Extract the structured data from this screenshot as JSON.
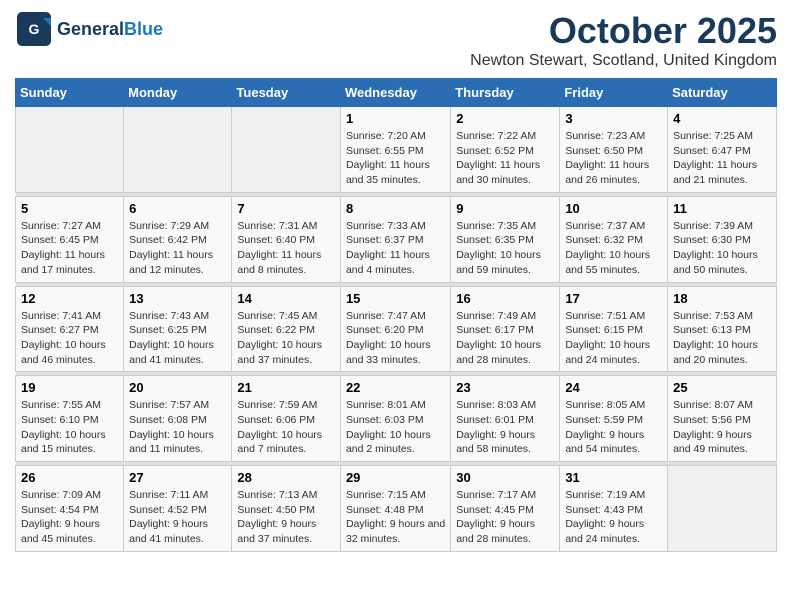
{
  "header": {
    "logo_general": "General",
    "logo_blue": "Blue",
    "month": "October 2025",
    "location": "Newton Stewart, Scotland, United Kingdom"
  },
  "weekdays": [
    "Sunday",
    "Monday",
    "Tuesday",
    "Wednesday",
    "Thursday",
    "Friday",
    "Saturday"
  ],
  "weeks": [
    [
      {
        "day": "",
        "sunrise": "",
        "sunset": "",
        "daylight": ""
      },
      {
        "day": "",
        "sunrise": "",
        "sunset": "",
        "daylight": ""
      },
      {
        "day": "",
        "sunrise": "",
        "sunset": "",
        "daylight": ""
      },
      {
        "day": "1",
        "sunrise": "Sunrise: 7:20 AM",
        "sunset": "Sunset: 6:55 PM",
        "daylight": "Daylight: 11 hours and 35 minutes."
      },
      {
        "day": "2",
        "sunrise": "Sunrise: 7:22 AM",
        "sunset": "Sunset: 6:52 PM",
        "daylight": "Daylight: 11 hours and 30 minutes."
      },
      {
        "day": "3",
        "sunrise": "Sunrise: 7:23 AM",
        "sunset": "Sunset: 6:50 PM",
        "daylight": "Daylight: 11 hours and 26 minutes."
      },
      {
        "day": "4",
        "sunrise": "Sunrise: 7:25 AM",
        "sunset": "Sunset: 6:47 PM",
        "daylight": "Daylight: 11 hours and 21 minutes."
      }
    ],
    [
      {
        "day": "5",
        "sunrise": "Sunrise: 7:27 AM",
        "sunset": "Sunset: 6:45 PM",
        "daylight": "Daylight: 11 hours and 17 minutes."
      },
      {
        "day": "6",
        "sunrise": "Sunrise: 7:29 AM",
        "sunset": "Sunset: 6:42 PM",
        "daylight": "Daylight: 11 hours and 12 minutes."
      },
      {
        "day": "7",
        "sunrise": "Sunrise: 7:31 AM",
        "sunset": "Sunset: 6:40 PM",
        "daylight": "Daylight: 11 hours and 8 minutes."
      },
      {
        "day": "8",
        "sunrise": "Sunrise: 7:33 AM",
        "sunset": "Sunset: 6:37 PM",
        "daylight": "Daylight: 11 hours and 4 minutes."
      },
      {
        "day": "9",
        "sunrise": "Sunrise: 7:35 AM",
        "sunset": "Sunset: 6:35 PM",
        "daylight": "Daylight: 10 hours and 59 minutes."
      },
      {
        "day": "10",
        "sunrise": "Sunrise: 7:37 AM",
        "sunset": "Sunset: 6:32 PM",
        "daylight": "Daylight: 10 hours and 55 minutes."
      },
      {
        "day": "11",
        "sunrise": "Sunrise: 7:39 AM",
        "sunset": "Sunset: 6:30 PM",
        "daylight": "Daylight: 10 hours and 50 minutes."
      }
    ],
    [
      {
        "day": "12",
        "sunrise": "Sunrise: 7:41 AM",
        "sunset": "Sunset: 6:27 PM",
        "daylight": "Daylight: 10 hours and 46 minutes."
      },
      {
        "day": "13",
        "sunrise": "Sunrise: 7:43 AM",
        "sunset": "Sunset: 6:25 PM",
        "daylight": "Daylight: 10 hours and 41 minutes."
      },
      {
        "day": "14",
        "sunrise": "Sunrise: 7:45 AM",
        "sunset": "Sunset: 6:22 PM",
        "daylight": "Daylight: 10 hours and 37 minutes."
      },
      {
        "day": "15",
        "sunrise": "Sunrise: 7:47 AM",
        "sunset": "Sunset: 6:20 PM",
        "daylight": "Daylight: 10 hours and 33 minutes."
      },
      {
        "day": "16",
        "sunrise": "Sunrise: 7:49 AM",
        "sunset": "Sunset: 6:17 PM",
        "daylight": "Daylight: 10 hours and 28 minutes."
      },
      {
        "day": "17",
        "sunrise": "Sunrise: 7:51 AM",
        "sunset": "Sunset: 6:15 PM",
        "daylight": "Daylight: 10 hours and 24 minutes."
      },
      {
        "day": "18",
        "sunrise": "Sunrise: 7:53 AM",
        "sunset": "Sunset: 6:13 PM",
        "daylight": "Daylight: 10 hours and 20 minutes."
      }
    ],
    [
      {
        "day": "19",
        "sunrise": "Sunrise: 7:55 AM",
        "sunset": "Sunset: 6:10 PM",
        "daylight": "Daylight: 10 hours and 15 minutes."
      },
      {
        "day": "20",
        "sunrise": "Sunrise: 7:57 AM",
        "sunset": "Sunset: 6:08 PM",
        "daylight": "Daylight: 10 hours and 11 minutes."
      },
      {
        "day": "21",
        "sunrise": "Sunrise: 7:59 AM",
        "sunset": "Sunset: 6:06 PM",
        "daylight": "Daylight: 10 hours and 7 minutes."
      },
      {
        "day": "22",
        "sunrise": "Sunrise: 8:01 AM",
        "sunset": "Sunset: 6:03 PM",
        "daylight": "Daylight: 10 hours and 2 minutes."
      },
      {
        "day": "23",
        "sunrise": "Sunrise: 8:03 AM",
        "sunset": "Sunset: 6:01 PM",
        "daylight": "Daylight: 9 hours and 58 minutes."
      },
      {
        "day": "24",
        "sunrise": "Sunrise: 8:05 AM",
        "sunset": "Sunset: 5:59 PM",
        "daylight": "Daylight: 9 hours and 54 minutes."
      },
      {
        "day": "25",
        "sunrise": "Sunrise: 8:07 AM",
        "sunset": "Sunset: 5:56 PM",
        "daylight": "Daylight: 9 hours and 49 minutes."
      }
    ],
    [
      {
        "day": "26",
        "sunrise": "Sunrise: 7:09 AM",
        "sunset": "Sunset: 4:54 PM",
        "daylight": "Daylight: 9 hours and 45 minutes."
      },
      {
        "day": "27",
        "sunrise": "Sunrise: 7:11 AM",
        "sunset": "Sunset: 4:52 PM",
        "daylight": "Daylight: 9 hours and 41 minutes."
      },
      {
        "day": "28",
        "sunrise": "Sunrise: 7:13 AM",
        "sunset": "Sunset: 4:50 PM",
        "daylight": "Daylight: 9 hours and 37 minutes."
      },
      {
        "day": "29",
        "sunrise": "Sunrise: 7:15 AM",
        "sunset": "Sunset: 4:48 PM",
        "daylight": "Daylight: 9 hours and 32 minutes."
      },
      {
        "day": "30",
        "sunrise": "Sunrise: 7:17 AM",
        "sunset": "Sunset: 4:45 PM",
        "daylight": "Daylight: 9 hours and 28 minutes."
      },
      {
        "day": "31",
        "sunrise": "Sunrise: 7:19 AM",
        "sunset": "Sunset: 4:43 PM",
        "daylight": "Daylight: 9 hours and 24 minutes."
      },
      {
        "day": "",
        "sunrise": "",
        "sunset": "",
        "daylight": ""
      }
    ]
  ]
}
